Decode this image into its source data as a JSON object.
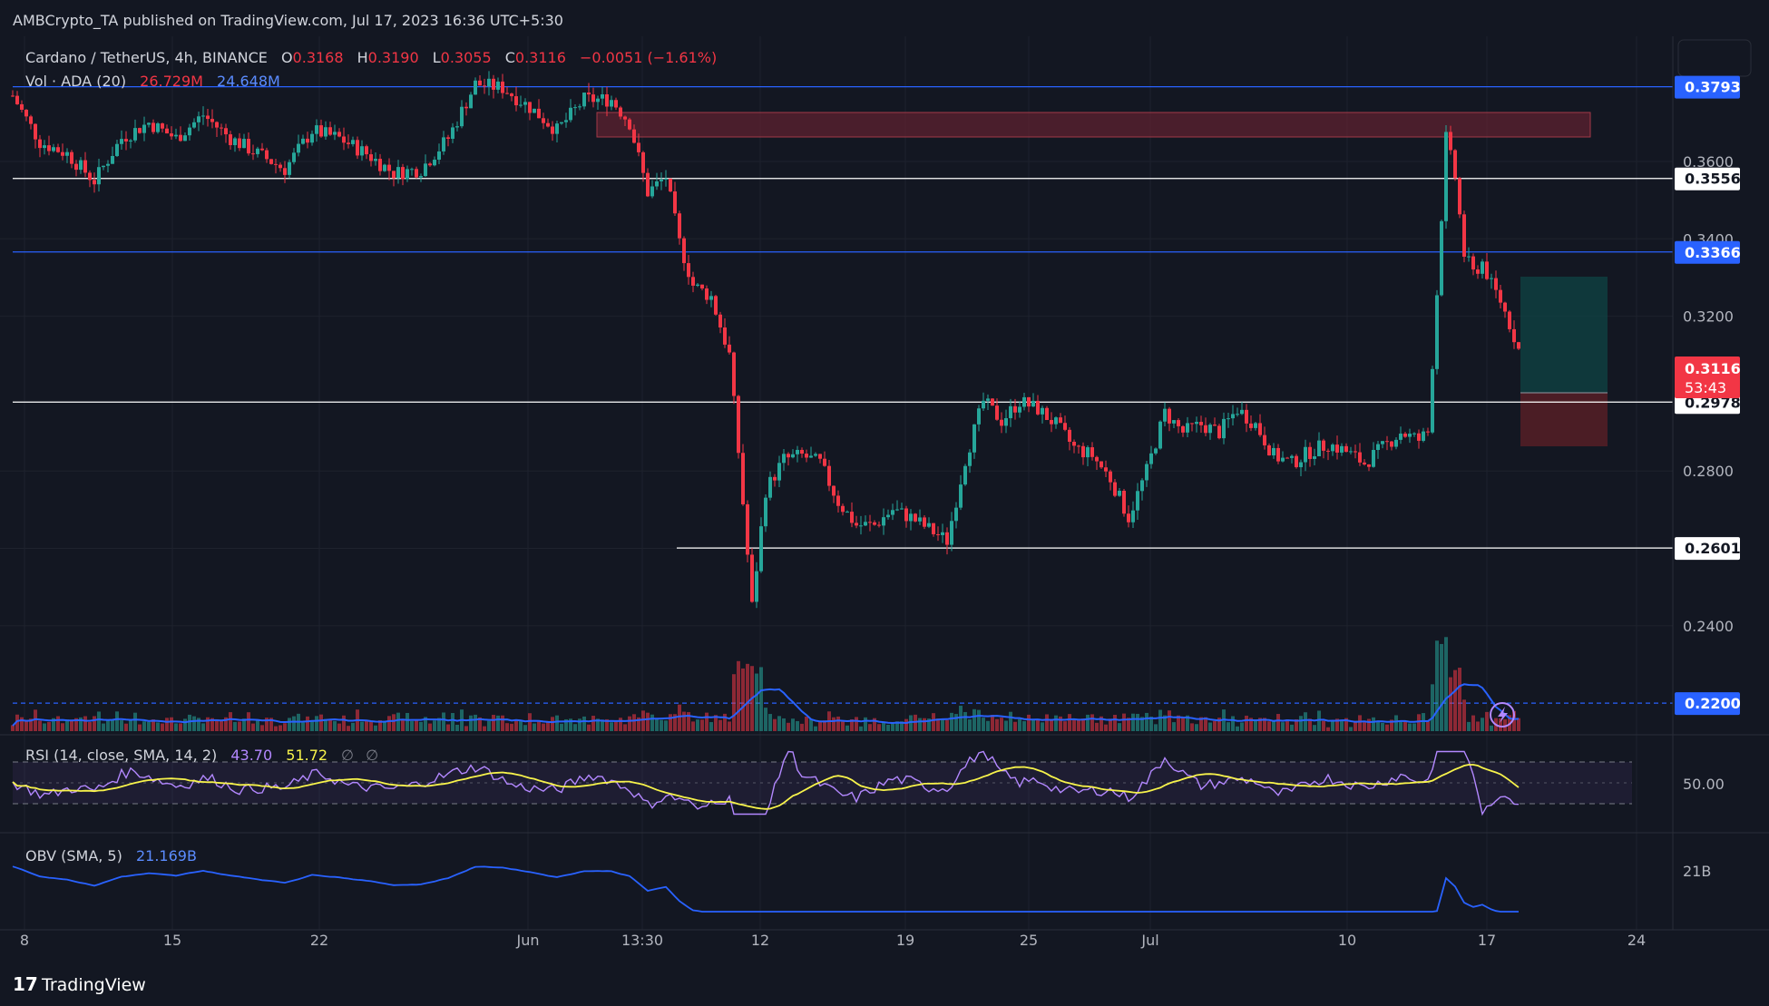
{
  "header": {
    "published": "AMBCrypto_TA published on TradingView.com, Jul 17, 2023 16:36 UTC+5:30",
    "symbol": "Cardano / TetherUS, 4h, BINANCE",
    "o_label": "O",
    "o_value": "0.3168",
    "h_label": "H",
    "h_value": "0.3190",
    "l_label": "L",
    "l_value": "0.3055",
    "c_label": "C",
    "c_value": "0.3116",
    "change": "−0.0051 (−1.61%)",
    "vol_label": "Vol · ADA (20)",
    "vol_value1": "26.729M",
    "vol_value2": "24.648M"
  },
  "rsi": {
    "label": "RSI (14, close, SMA, 14, 2)",
    "value1": "43.70",
    "value2": "51.72",
    "extra1": "∅",
    "extra2": "∅",
    "axis_label": "50.00"
  },
  "obv": {
    "label": "OBV (SMA, 5)",
    "value": "21.169B",
    "axis_label": "21B"
  },
  "footer": {
    "brand": "TradingView"
  },
  "colors": {
    "background": "#131722",
    "up": "#26a69a",
    "down": "#f23645",
    "blue_line": "#2962ff",
    "rsi": "#b388ff",
    "rsi_sma": "#f7f34b",
    "obv": "#2962ff"
  },
  "chart_data": {
    "type": "candlestick",
    "timeframe": "4h",
    "price_axis": [
      "0.3600",
      "0.3400",
      "0.3200",
      "0.2800",
      "0.2600",
      "0.2400"
    ],
    "price_range": [
      0.213,
      0.39
    ],
    "x_ticks": [
      "8",
      "15",
      "22",
      "Jun",
      "13:30",
      "12",
      "19",
      "25",
      "Jul",
      "10",
      "17",
      "24"
    ],
    "levels": [
      {
        "value": "0.3793",
        "style": "blue"
      },
      {
        "value": "0.3556",
        "style": "white"
      },
      {
        "value": "0.3366",
        "style": "blue"
      },
      {
        "value": "0.2978",
        "style": "white"
      },
      {
        "value": "0.2601",
        "style": "white"
      },
      {
        "value": "0.2200",
        "style": "blue-dashed"
      }
    ],
    "current_price": "0.3116",
    "countdown": "53:43",
    "price_path": [
      [
        0,
        0.377
      ],
      [
        30,
        0.365
      ],
      [
        60,
        0.362
      ],
      [
        90,
        0.355
      ],
      [
        120,
        0.366
      ],
      [
        150,
        0.37
      ],
      [
        180,
        0.366
      ],
      [
        210,
        0.372
      ],
      [
        240,
        0.366
      ],
      [
        270,
        0.362
      ],
      [
        300,
        0.358
      ],
      [
        330,
        0.368
      ],
      [
        360,
        0.366
      ],
      [
        390,
        0.362
      ],
      [
        420,
        0.357
      ],
      [
        450,
        0.358
      ],
      [
        480,
        0.366
      ],
      [
        510,
        0.38
      ],
      [
        540,
        0.379
      ],
      [
        570,
        0.374
      ],
      [
        600,
        0.368
      ],
      [
        630,
        0.376
      ],
      [
        660,
        0.376
      ],
      [
        680,
        0.37
      ],
      [
        700,
        0.352
      ],
      [
        720,
        0.356
      ],
      [
        735,
        0.339
      ],
      [
        750,
        0.328
      ],
      [
        770,
        0.325
      ],
      [
        790,
        0.31
      ],
      [
        800,
        0.285
      ],
      [
        815,
        0.245
      ],
      [
        830,
        0.275
      ],
      [
        850,
        0.283
      ],
      [
        870,
        0.284
      ],
      [
        890,
        0.282
      ],
      [
        910,
        0.272
      ],
      [
        930,
        0.266
      ],
      [
        950,
        0.266
      ],
      [
        970,
        0.27
      ],
      [
        990,
        0.268
      ],
      [
        1010,
        0.265
      ],
      [
        1030,
        0.262
      ],
      [
        1050,
        0.283
      ],
      [
        1070,
        0.298
      ],
      [
        1090,
        0.293
      ],
      [
        1110,
        0.298
      ],
      [
        1130,
        0.296
      ],
      [
        1150,
        0.292
      ],
      [
        1170,
        0.286
      ],
      [
        1190,
        0.284
      ],
      [
        1210,
        0.278
      ],
      [
        1230,
        0.268
      ],
      [
        1250,
        0.28
      ],
      [
        1270,
        0.295
      ],
      [
        1290,
        0.29
      ],
      [
        1310,
        0.292
      ],
      [
        1330,
        0.29
      ],
      [
        1350,
        0.296
      ],
      [
        1370,
        0.292
      ],
      [
        1390,
        0.284
      ],
      [
        1410,
        0.282
      ],
      [
        1430,
        0.285
      ],
      [
        1450,
        0.287
      ],
      [
        1470,
        0.285
      ],
      [
        1490,
        0.282
      ],
      [
        1510,
        0.286
      ],
      [
        1530,
        0.29
      ],
      [
        1550,
        0.288
      ],
      [
        1560,
        0.29
      ],
      [
        1570,
        0.326
      ],
      [
        1580,
        0.366
      ],
      [
        1590,
        0.356
      ],
      [
        1600,
        0.336
      ],
      [
        1610,
        0.331
      ],
      [
        1620,
        0.334
      ],
      [
        1630,
        0.328
      ],
      [
        1640,
        0.324
      ],
      [
        1650,
        0.318
      ],
      [
        1660,
        0.3116
      ]
    ],
    "rsi_range": [
      20,
      80
    ],
    "obv_level": "21B"
  }
}
